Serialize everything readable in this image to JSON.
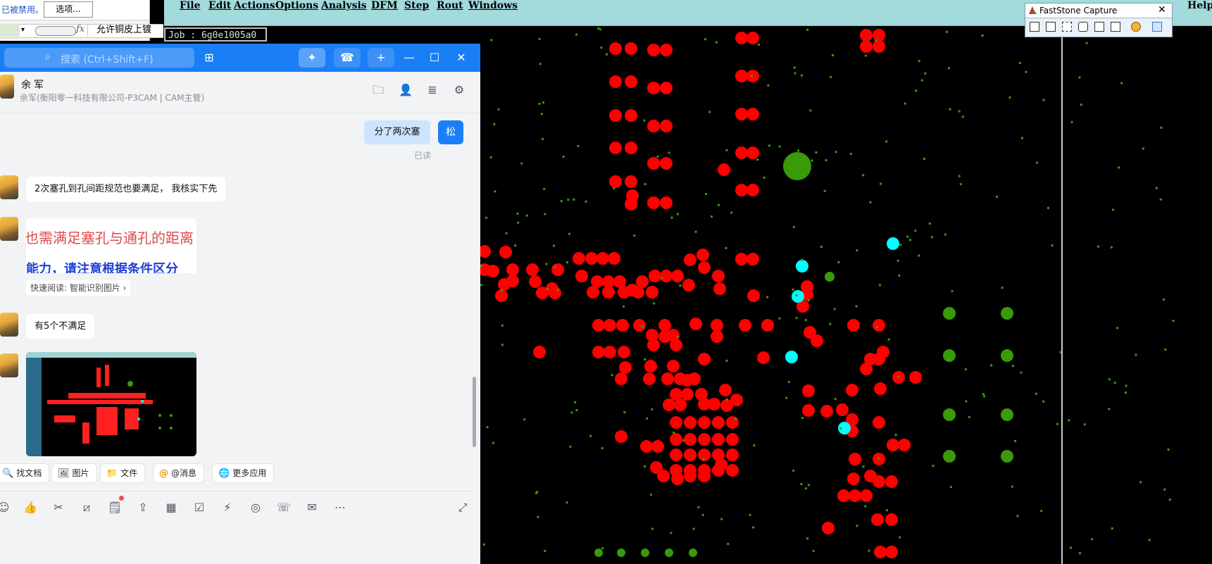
{
  "excel": {
    "banner_text": "已被禁用。",
    "options_button": "选项...",
    "dropdown_glyph": "▾",
    "fx_label": "fx",
    "cell_text": "允许铜皮上镀"
  },
  "cam": {
    "menus": [
      "File",
      "Edit",
      "Actions",
      "Options",
      "Analysis",
      "DFM",
      "Step",
      "Rout",
      "Windows"
    ],
    "help": "Help",
    "job": "Job : 6g0e1005a0"
  },
  "faststone": {
    "title": "FastStone Capture",
    "close": "✕"
  },
  "chat": {
    "search_placeholder": "搜索 (Ctrl+Shift+F)",
    "contact_name": "余军",
    "contact_desc": "余军(衡阳零一科技有限公司-P3CAM | CAM主管)",
    "out_message": "分了两次塞",
    "self_avatar": "松",
    "read_status": "已读",
    "msg1": "2次塞孔到孔间距规范也要满足， 我核实下先",
    "img1_line1": "也需满足塞孔与通孔的距离",
    "img1_line2": "能力，请注意根据条件区分",
    "img1_chip": "快速阅读: 智能识别图片 ›",
    "msg2": "有5个不满足",
    "quick_actions": [
      {
        "icon": "🔍",
        "label": "找文档"
      },
      {
        "icon": "🖼",
        "label": "图片"
      },
      {
        "icon": "📁",
        "label": "文件"
      },
      {
        "icon": "@",
        "label": "@消息"
      },
      {
        "icon": "🌐",
        "label": "更多应用"
      }
    ]
  },
  "colors": {
    "pad_red": "#ff0000",
    "via_green": "#3a9a0a",
    "highlight_cyan": "#00ffff",
    "chat_blue": "#1a7ff6",
    "cam_menubar": "#a3dadb"
  }
}
